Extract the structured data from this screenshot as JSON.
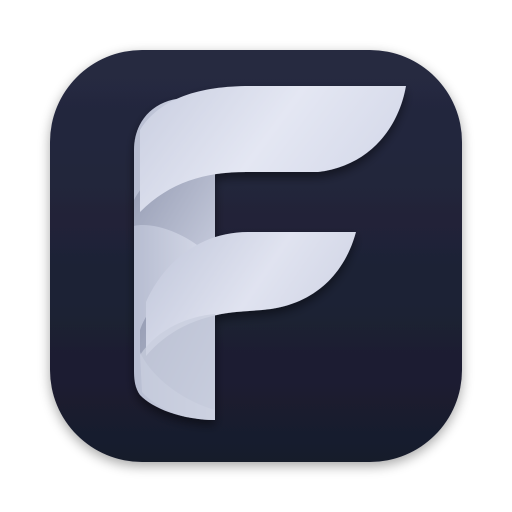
{
  "app_icon": {
    "icon": "letter-f-logo-icon",
    "letter": "F",
    "colors": {
      "tile_background": "#20243a",
      "tile_background_dark": "#151828",
      "letter_light": "#dfe3f1",
      "letter_mid": "#b4bace",
      "letter_shadow": "#7e859e",
      "page_background": "#ffffff"
    }
  }
}
